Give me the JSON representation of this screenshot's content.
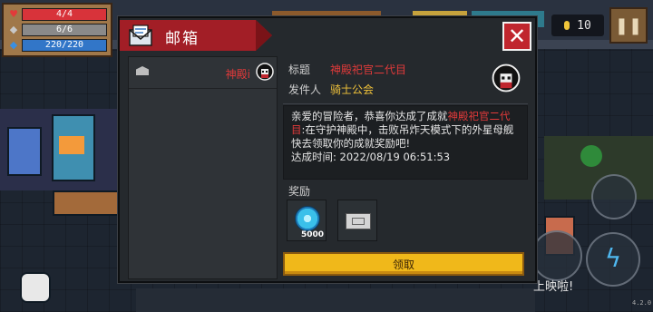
{
  "hud": {
    "hp": "4/4",
    "armor": "6/6",
    "energy": "220/220",
    "hp_icon": "heart-icon",
    "armor_icon": "shield-icon",
    "energy_icon": "energy-crystal-icon"
  },
  "coins": {
    "value": "10",
    "icon": "coin-icon"
  },
  "pause_icon": "pause-icon",
  "dialog": {
    "title": "邮箱",
    "title_icon": "mail-icon",
    "close_icon": "close-icon"
  },
  "mail_list": [
    {
      "sender": "神殿i",
      "icon": "envelope-icon",
      "avatar": "cult-leader-avatar-icon"
    }
  ],
  "mail_detail": {
    "title_label": "标题",
    "title_value": "神殿祀官二代目",
    "sender_label": "发件人",
    "sender_value": "骑士公会",
    "body": {
      "part1": "亲爱的冒险者，恭喜你达成了成就",
      "highlight": "神殿祀官二代目",
      "part2": ":在守护神殿中，击败吊炸天模式下的外星母舰",
      "line2": "快去领取你的成就奖励吧!",
      "line3": "达成时间: 2022/08/19 06:51:53"
    },
    "reward_label": "奖励",
    "rewards": [
      {
        "icon": "gem-icon",
        "count": "5000"
      },
      {
        "icon": "ticket-icon",
        "count": ""
      }
    ],
    "claim_label": "领取"
  },
  "background": {
    "movie_text": "上映啦!",
    "version": "4.2.0"
  },
  "colors": {
    "accent_red": "#a21e26",
    "highlight_red": "#e23a3a",
    "gold": "#f0c23a",
    "claim_button": "#f0b81a"
  }
}
